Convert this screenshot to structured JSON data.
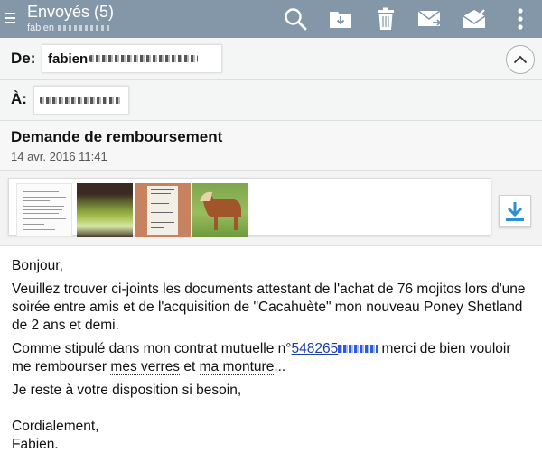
{
  "topbar": {
    "folder_title": "Envoyés (5)",
    "account_name": "fabien",
    "actions": [
      "search-icon",
      "move-to-folder-icon",
      "delete-icon",
      "forward-icon",
      "mark-read-icon",
      "more-vert-icon"
    ],
    "background": "#8397a8"
  },
  "header": {
    "from_label": "De:",
    "from_value": "fabien",
    "to_label": "À:",
    "subject": "Demande de remboursement",
    "date": "14 avr. 2016 11:41"
  },
  "attachments": {
    "items": [
      "document-thumbnail",
      "mojitos-photo-thumbnail",
      "receipt-photo-thumbnail",
      "pony-photo-thumbnail"
    ],
    "download_icon": "download-icon",
    "accent": "#2b8fd6"
  },
  "body": {
    "greeting": "Bonjour,",
    "paragraph1": "Veuillez trouver ci-joints les documents attestant de l'achat de 76 mojitos lors d'une soirée entre amis et de l'acquisition de \"Cacahuète\" mon nouveau Poney Shetland de 2 ans et demi.",
    "p2_before": "Comme stipulé dans mon contrat mutuelle n°",
    "p2_contract": "548265",
    "p2_after": " merci de bien vouloir me rembourser ",
    "p2_verres": "mes verres",
    "p2_et": " et ",
    "p2_monture": "ma monture",
    "p2_end": "...",
    "paragraph3": "Je reste à votre disposition si besoin,",
    "closing": "Cordialement,",
    "signature": "Fabien."
  }
}
